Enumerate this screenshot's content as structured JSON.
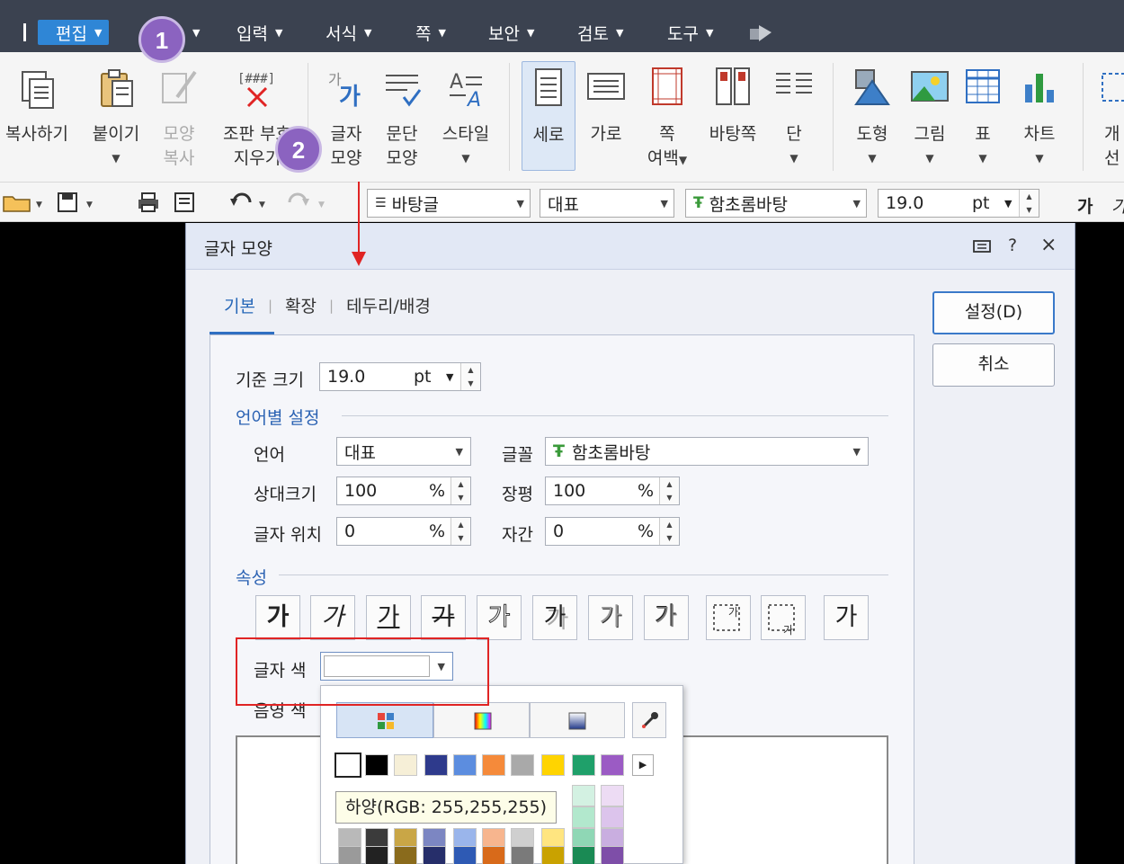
{
  "menubar": {
    "items": [
      {
        "label": "편집",
        "active": true
      },
      {
        "label": "입력"
      },
      {
        "label": "서식"
      },
      {
        "label": "쪽"
      },
      {
        "label": "보안"
      },
      {
        "label": "검토"
      },
      {
        "label": "도구"
      }
    ]
  },
  "ribbon": {
    "copy": "복사하기",
    "paste": "붙이기",
    "format_copy_1": "모양",
    "format_copy_2": "복사",
    "clear_1": "조판 부호",
    "clear_2": "지우기",
    "char_shape_1": "글자",
    "char_shape_2": "모양",
    "para_shape_1": "문단",
    "para_shape_2": "모양",
    "style": "스타일",
    "vertical": "세로",
    "horizontal": "가로",
    "margin_1": "쪽",
    "margin_2": "여백",
    "master_page": "바탕쪽",
    "columns": "단",
    "shape": "도형",
    "picture": "그림",
    "table": "표",
    "chart": "차트",
    "obj_select_1": "개",
    "obj_select_2": "선"
  },
  "toolbar": {
    "style_value": "바탕글",
    "language_value": "대표",
    "font_value": "함초롬바탕",
    "size_value": "19.0",
    "size_unit": "pt",
    "bold_glyph": "가"
  },
  "dialog": {
    "title": "글자 모양",
    "help": "?",
    "close": "×",
    "tabs": [
      "기본",
      "확장",
      "테두리/배경"
    ],
    "ok_label": "설정(D)",
    "cancel_label": "취소",
    "base_size_label": "기준 크기",
    "base_size_value": "19.0",
    "base_size_unit": "pt",
    "lang_section": "언어별 설정",
    "language_label": "언어",
    "language_value": "대표",
    "font_label": "글꼴",
    "font_value": "함초롬바탕",
    "rel_size_label": "상대크기",
    "rel_size_value": "100",
    "width_label": "장평",
    "width_value": "100",
    "position_label": "글자 위치",
    "position_value": "0",
    "spacing_label": "자간",
    "spacing_value": "0",
    "percent": "%",
    "attr_section": "속성",
    "attr_glyph": "가",
    "text_color_label": "글자 색",
    "shade_color_label": "음영 색",
    "tooltip": "하양(RGB: 255,255,255)"
  },
  "palette_colors": [
    "#ffffff",
    "#000000",
    "#f6efd7",
    "#2e3a8c",
    "#5c8ddf",
    "#f58a3a",
    "#a9a9a9",
    "#ffd400",
    "#1fa06a",
    "#9b5bc4"
  ],
  "badges": [
    "1",
    "2"
  ],
  "accent": "#2f86d6"
}
